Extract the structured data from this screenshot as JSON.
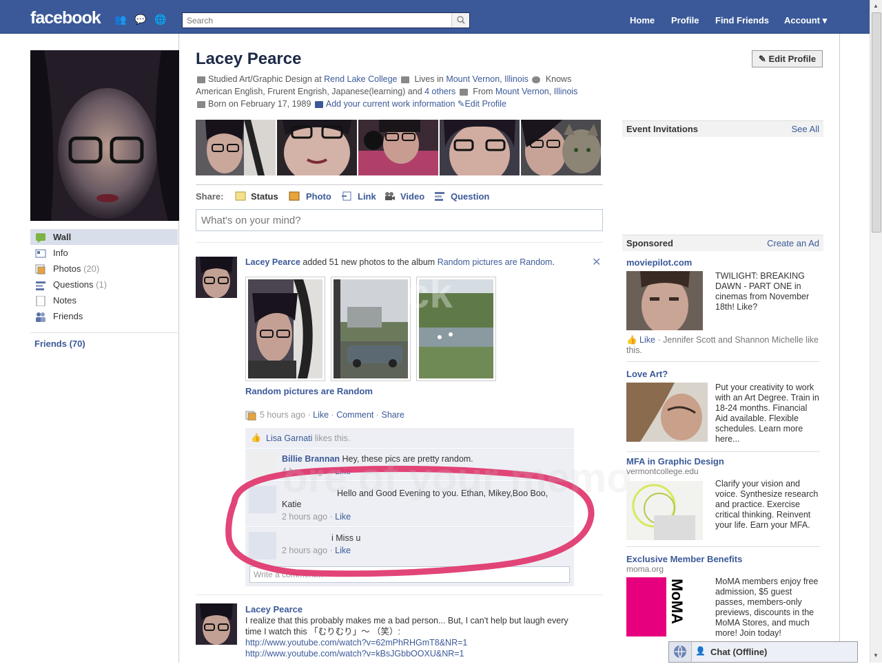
{
  "topbar": {
    "logo": "facebook",
    "search_placeholder": "Search",
    "nav": [
      "Home",
      "Profile",
      "Find Friends",
      "Account ▾"
    ]
  },
  "profile": {
    "name": "Lacey Pearce",
    "edit_button": "Edit Profile",
    "info_line1_a": "Studied Art/Graphic Design at ",
    "info_line1_school": "Rend Lake College",
    "info_line1_b": " Lives in ",
    "info_line1_city": "Mount Vernon",
    "info_line1_sep": ", ",
    "info_line1_state": "Illinois",
    "info_line1_c": " Knows",
    "info_line2_a": "American English, Frurent Engrish, Japanese(learning) and ",
    "info_line2_others": "4 others",
    "info_line2_from": " From ",
    "info_line2_city": "Mount Vernon",
    "info_line2_state": "Illinois",
    "info_line3_born": "Born on February 17, 1989",
    "info_line3_work": "Add your current work information",
    "info_line3_edit": "Edit Profile"
  },
  "leftnav": {
    "items": [
      {
        "label": "Wall",
        "count": ""
      },
      {
        "label": "Info",
        "count": ""
      },
      {
        "label": "Photos",
        "count": "(20)"
      },
      {
        "label": "Questions",
        "count": "(1)"
      },
      {
        "label": "Notes",
        "count": ""
      },
      {
        "label": "Friends",
        "count": ""
      }
    ],
    "friends_heading": "Friends (70)"
  },
  "share": {
    "label": "Share:",
    "options": [
      "Status",
      "Photo",
      "Link",
      "Video",
      "Question"
    ],
    "composer_placeholder": "What's on your mind?"
  },
  "story1": {
    "author": "Lacey Pearce",
    "action": " added 51 new photos to the album ",
    "album": "Random pictures are Random",
    "period": ".",
    "album_title": "Random pictures are Random",
    "time": "5 hours ago",
    "actions": [
      "Like",
      "Comment",
      "Share"
    ],
    "likes": "Lisa Garnati",
    "likes_suffix": " likes this.",
    "comments": [
      {
        "author": "Billie Brannan",
        "text": " Hey, these pics are pretty random.",
        "time": "4 hours ago",
        "like": "Like"
      },
      {
        "author": "",
        "text": "Hello and Good Evening to you. Ethan, Mikey,Boo Boo,",
        "text2": "Katie",
        "time": "2 hours ago",
        "like": "Like"
      },
      {
        "author": "",
        "text": "i Miss u",
        "time": "2 hours ago",
        "like": "Like"
      }
    ],
    "write_placeholder": "Write a comment..."
  },
  "story2": {
    "author": "Lacey Pearce",
    "text": "I realize that this probably makes me a bad person... But, I can't help but laugh every time I watch this 「むりむり」～ （笑）:",
    "link1": "http://www.youtube.com/watch?v=62mPhRHGmT8&NR=1",
    "link2": "http://www.youtube.com/watch?v=kBsJGbbOOXU&NR=1"
  },
  "right": {
    "events_title": "Event Invitations",
    "events_link": "See All",
    "sponsored_title": "Sponsored",
    "sponsored_link": "Create an Ad",
    "ads": [
      {
        "title": "moviepilot.com",
        "text": "TWILIGHT: BREAKING DAWN - PART ONE in cinemas from November 18th! Like?",
        "like": "Like",
        "social": " · Jennifer Scott and Shannon Michelle like this."
      },
      {
        "title": "Love Art?",
        "text": "Put your creativity to work with an Art Degree. Train in 18-24 months. Financial Aid available. Flexible schedules. Learn more here..."
      },
      {
        "title": "MFA in Graphic Design",
        "sub": "vermontcollege.edu",
        "text": "Clarify your vision and voice. Synthesize research and practice. Exercise critical thinking. Reinvent your life. Earn your MFA."
      },
      {
        "title": "Exclusive Member Benefits",
        "sub": "moma.org",
        "text": "MoMA members enjoy free admission, $5 guest passes, members-only previews, discounts in the MoMA Stores, and much more! Join today!"
      }
    ],
    "moma_logo": "MoMA"
  },
  "chat": {
    "label": "Chat (Offline)"
  },
  "watermark": "ore of your memo",
  "watermark2": "ck",
  "colors": {
    "brand": "#3b5998",
    "highlight": "#d8dfea",
    "annotation": "#e0356b"
  }
}
